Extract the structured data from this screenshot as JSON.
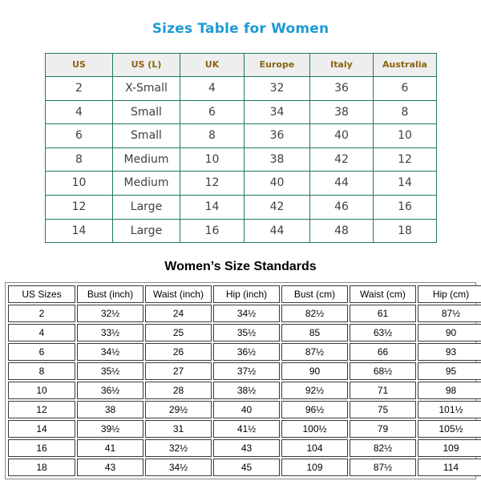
{
  "colors": {
    "title_one": "#1e9ad2",
    "title_two": "#000000",
    "table_one_border": "#1f7a5c",
    "table_one_header_bg": "#eeeeee",
    "table_one_header_text": "#8a6410",
    "table_two_border": "#3a3a3a"
  },
  "table_one": {
    "title": "Sizes Table for Women",
    "headers": [
      "US",
      "US (L)",
      "UK",
      "Europe",
      "Italy",
      "Australia"
    ],
    "rows": [
      [
        "2",
        "X-Small",
        "4",
        "32",
        "36",
        "6"
      ],
      [
        "4",
        "Small",
        "6",
        "34",
        "38",
        "8"
      ],
      [
        "6",
        "Small",
        "8",
        "36",
        "40",
        "10"
      ],
      [
        "8",
        "Medium",
        "10",
        "38",
        "42",
        "12"
      ],
      [
        "10",
        "Medium",
        "12",
        "40",
        "44",
        "14"
      ],
      [
        "12",
        "Large",
        "14",
        "42",
        "46",
        "16"
      ],
      [
        "14",
        "Large",
        "16",
        "44",
        "48",
        "18"
      ]
    ]
  },
  "table_two": {
    "title": "Women’s Size Standards",
    "headers": [
      "US Sizes",
      "Bust (inch)",
      "Waist (inch)",
      "Hip (inch)",
      "Bust (cm)",
      "Waist (cm)",
      "Hip (cm)"
    ],
    "rows": [
      [
        "2",
        "32½",
        "24",
        "34½",
        "82½",
        "61",
        "87½"
      ],
      [
        "4",
        "33½",
        "25",
        "35½",
        "85",
        "63½",
        "90"
      ],
      [
        "6",
        "34½",
        "26",
        "36½",
        "87½",
        "66",
        "93"
      ],
      [
        "8",
        "35½",
        "27",
        "37½",
        "90",
        "68½",
        "95"
      ],
      [
        "10",
        "36½",
        "28",
        "38½",
        "92½",
        "71",
        "98"
      ],
      [
        "12",
        "38",
        "29½",
        "40",
        "96½",
        "75",
        "101½"
      ],
      [
        "14",
        "39½",
        "31",
        "41½",
        "100½",
        "79",
        "105½"
      ],
      [
        "16",
        "41",
        "32½",
        "43",
        "104",
        "82½",
        "109"
      ],
      [
        "18",
        "43",
        "34½",
        "45",
        "109",
        "87½",
        "114"
      ]
    ]
  }
}
